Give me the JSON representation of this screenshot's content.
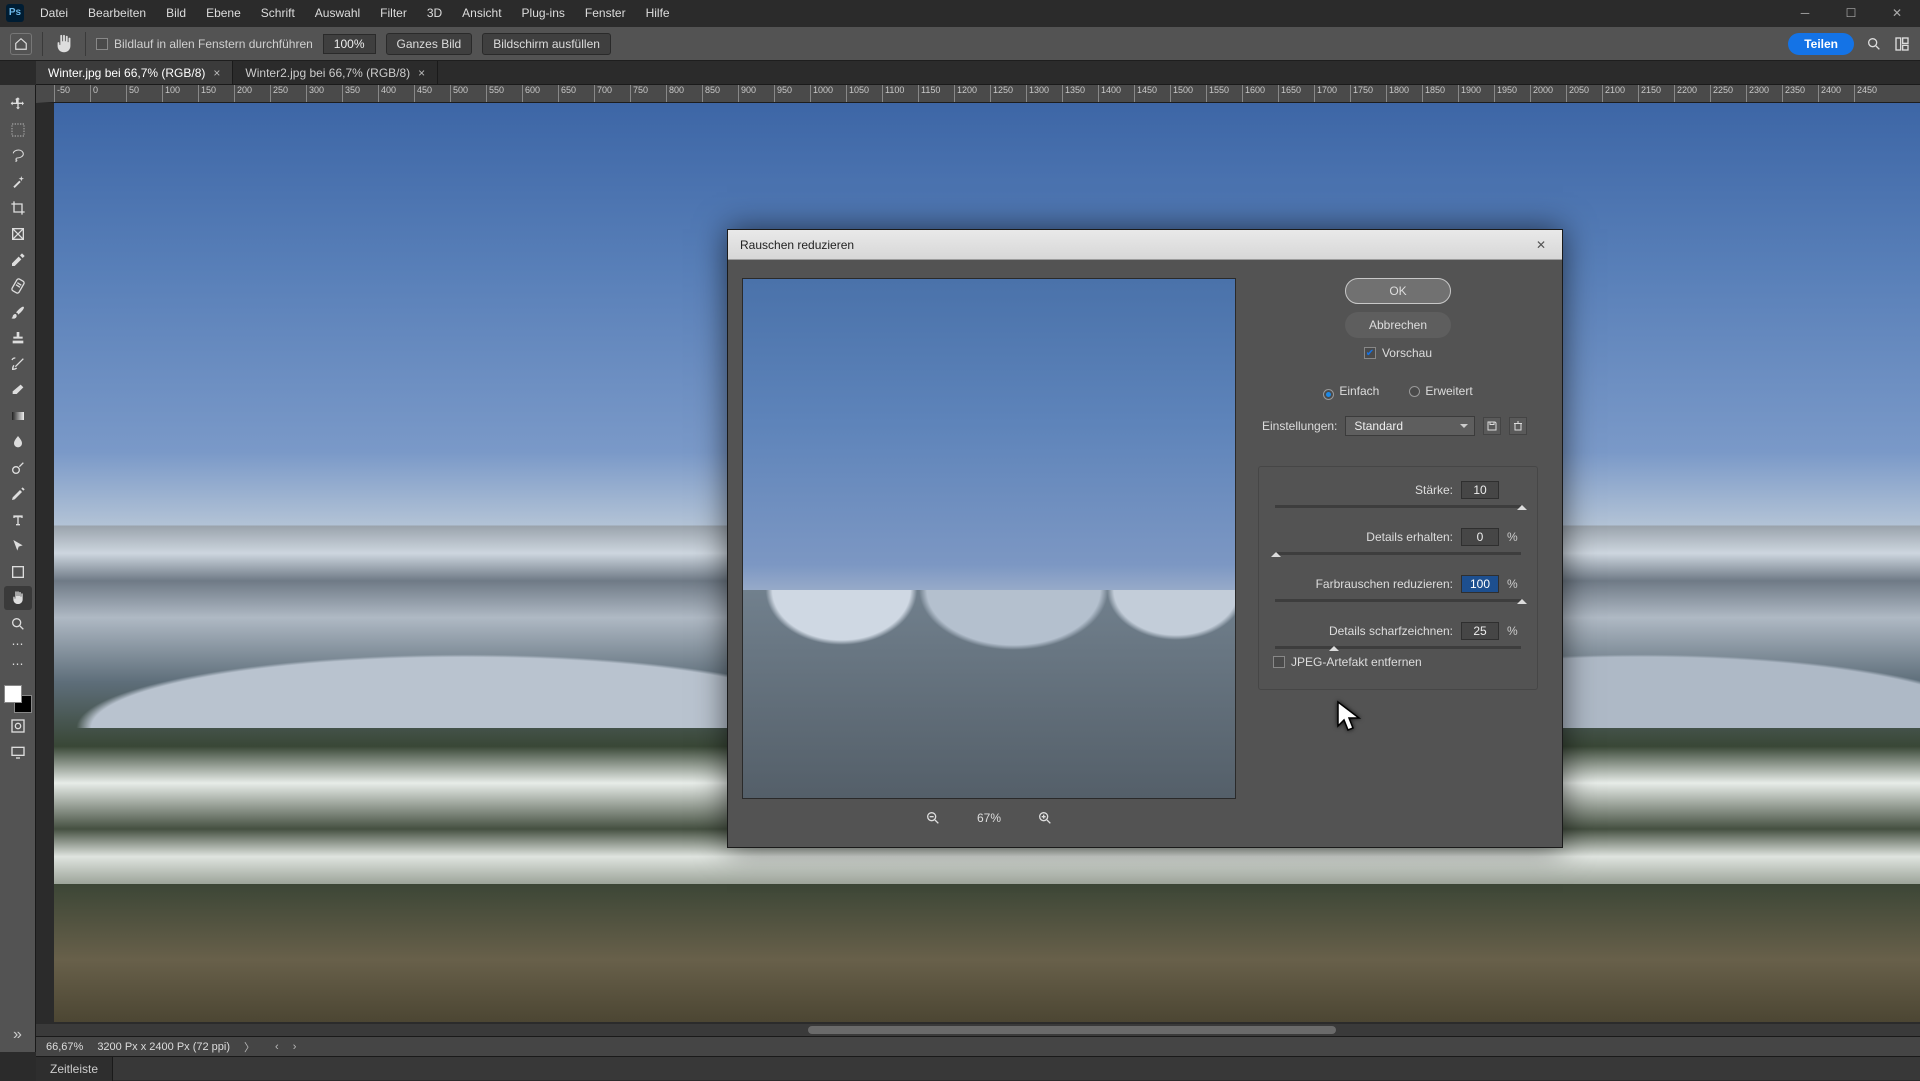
{
  "app_logo": "Ps",
  "menu": [
    "Datei",
    "Bearbeiten",
    "Bild",
    "Ebene",
    "Schrift",
    "Auswahl",
    "Filter",
    "3D",
    "Ansicht",
    "Plug-ins",
    "Fenster",
    "Hilfe"
  ],
  "options_bar": {
    "scroll_all_label": "Bildlauf in allen Fenstern durchführen",
    "zoom_field": "100%",
    "fit_whole": "Ganzes Bild",
    "fit_screen": "Bildschirm ausfüllen",
    "share": "Teilen"
  },
  "tabs": [
    {
      "label": "Winter.jpg bei 66,7% (RGB/8)",
      "active": true
    },
    {
      "label": "Winter2.jpg bei 66,7% (RGB/8)",
      "active": false
    }
  ],
  "ruler_ticks": [
    -50,
    0,
    50,
    100,
    150,
    200,
    250,
    300,
    350,
    400,
    450,
    500,
    550,
    600,
    650,
    700,
    750,
    800,
    850,
    900,
    950,
    1000,
    1050,
    1100,
    1150,
    1200,
    1250,
    1300,
    1350,
    1400,
    1450,
    1500,
    1550,
    1600,
    1650,
    1700,
    1750,
    1800,
    1850,
    1900,
    1950,
    2000,
    2050,
    2100,
    2150,
    2200,
    2250,
    2300,
    2350,
    2400,
    2450
  ],
  "status": {
    "zoom": "66,67%",
    "info": "3200 Px x 2400 Px (72 ppi)"
  },
  "timeline_tab": "Zeitleiste",
  "dialog": {
    "title": "Rauschen reduzieren",
    "ok": "OK",
    "cancel": "Abbrechen",
    "preview": "Vorschau",
    "mode_simple": "Einfach",
    "mode_advanced": "Erweitert",
    "settings_label": "Einstellungen:",
    "settings_value": "Standard",
    "strength_label": "Stärke:",
    "strength_value": "10",
    "preserve_label": "Details erhalten:",
    "preserve_value": "0",
    "color_label": "Farbrauschen reduzieren:",
    "color_value": "100",
    "sharpen_label": "Details scharfzeichnen:",
    "sharpen_value": "25",
    "percent": "%",
    "jpeg_label": "JPEG-Artefakt entfernen",
    "pv_zoom": "67%"
  }
}
